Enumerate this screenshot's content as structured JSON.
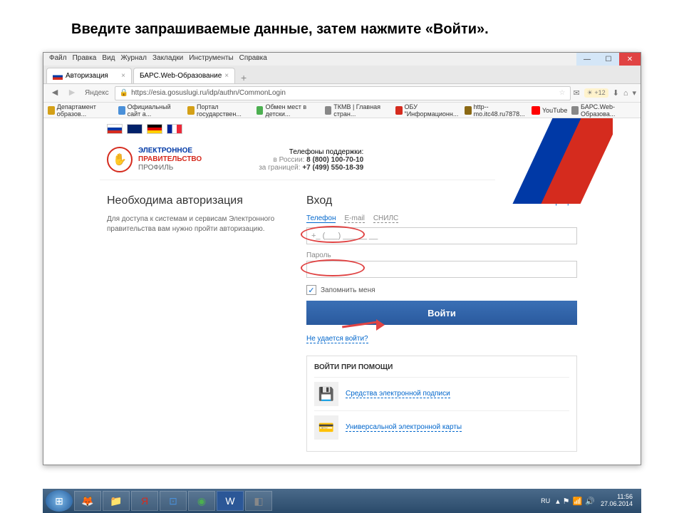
{
  "slide": {
    "instruction": "Введите запрашиваемые данные, затем  нажмите «Войти»."
  },
  "window": {
    "menu": [
      "Файл",
      "Правка",
      "Вид",
      "Журнал",
      "Закладки",
      "Инструменты",
      "Справка"
    ],
    "tabs": [
      {
        "label": "Авторизация"
      },
      {
        "label": "БАРС.Web-Образование"
      }
    ],
    "yandex_label": "Яндекс",
    "url": "https://esia.gosuslugi.ru/idp/authn/CommonLogin",
    "weather": "+12",
    "bookmarks": [
      {
        "label": "Департамент образов...",
        "color": "#d4a017"
      },
      {
        "label": "Официальный сайт а...",
        "color": "#4a90d9"
      },
      {
        "label": "Портал государствен...",
        "color": "#d4a017"
      },
      {
        "label": "Обмен мест в детски...",
        "color": "#4caf50"
      },
      {
        "label": "ТКМВ | Главная стран...",
        "color": "#888"
      },
      {
        "label": "ОБУ \"Информационн...",
        "color": "#d52b1e"
      },
      {
        "label": "http--mo.itc48.ru7878...",
        "color": "#8b6914"
      },
      {
        "label": "YouTube",
        "color": "#ff0000"
      },
      {
        "label": "БАРС.Web-Образова...",
        "color": "#888"
      }
    ]
  },
  "page": {
    "logo": {
      "line1": "ЭЛЕКТРОННОЕ",
      "line2": "ПРАВИТЕЛЬСТВО",
      "line3": "ПРОФИЛЬ"
    },
    "support": {
      "title": "Телефоны поддержки:",
      "ru_label": "в России:",
      "ru_phone": "8 (800) 100-70-10",
      "abroad_label": "за границей:",
      "abroad_phone": "+7 (499) 550-18-39"
    },
    "left": {
      "title": "Необходима авторизация",
      "text": "Для доступа к системам и сервисам Электронного правительства вам нужно пройти авторизацию."
    },
    "login": {
      "title": "Вход",
      "register": "Регистрация",
      "tabs": [
        "Телефон",
        "E-mail",
        "СНИЛС"
      ],
      "phone_mask": "+_ (___) ___ __ __",
      "password_label": "Пароль",
      "remember": "Запомнить меня",
      "button": "Войти",
      "forgot": "Не удается войти?"
    },
    "alt": {
      "title": "ВОЙТИ ПРИ ПОМОЩИ",
      "option1": "Средства электронной подписи",
      "option2": "Универсальной электронной карты"
    }
  },
  "taskbar": {
    "lang": "RU",
    "time": "11:56",
    "date": "27.06.2014"
  }
}
